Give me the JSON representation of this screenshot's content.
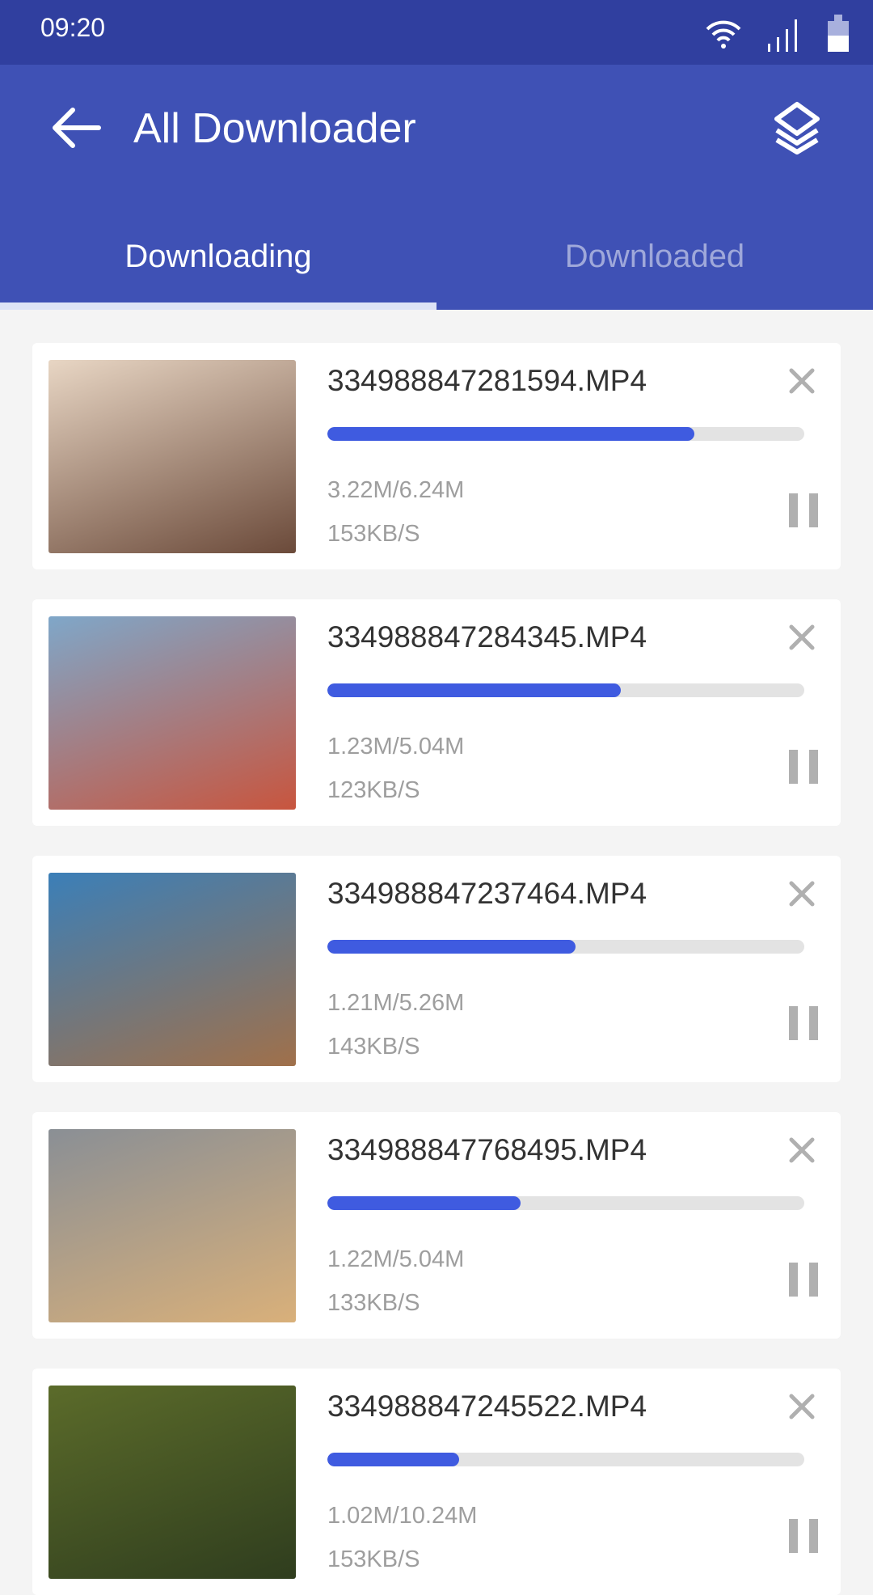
{
  "status_bar": {
    "time": "09:20",
    "icons": [
      "wifi-icon",
      "signal-icon",
      "battery-icon"
    ]
  },
  "app_bar": {
    "title": "All Downloader",
    "back_icon": "arrow-left-icon",
    "action_icon": "layers-icon"
  },
  "tabs": [
    {
      "label": "Downloading",
      "active": true
    },
    {
      "label": "Downloaded",
      "active": false
    }
  ],
  "colors": {
    "primary": "#3f51b5",
    "status_bar": "#303f9f",
    "progress": "#3f5be0"
  },
  "downloads": [
    {
      "filename": "334988847281594.MP4",
      "size": "3.22M/6.24M",
      "speed": "153KB/S",
      "progress": 0.77,
      "thumb": [
        "#e8d6c4",
        "#6b4a3a"
      ]
    },
    {
      "filename": "334988847284345.MP4",
      "size": "1.23M/5.04M",
      "speed": "123KB/S",
      "progress": 0.615,
      "thumb": [
        "#7fa7c9",
        "#c8553e"
      ]
    },
    {
      "filename": "334988847237464.MP4",
      "size": "1.21M/5.26M",
      "speed": "143KB/S",
      "progress": 0.52,
      "thumb": [
        "#3b7fb8",
        "#a0704a"
      ]
    },
    {
      "filename": "334988847768495.MP4",
      "size": "1.22M/5.04M",
      "speed": "133KB/S",
      "progress": 0.405,
      "thumb": [
        "#8a8f95",
        "#d9b07a"
      ]
    },
    {
      "filename": "334988847245522.MP4",
      "size": "1.02M/10.24M",
      "speed": "153KB/S",
      "progress": 0.277,
      "thumb": [
        "#5b6b2a",
        "#2f3d1e"
      ]
    }
  ]
}
